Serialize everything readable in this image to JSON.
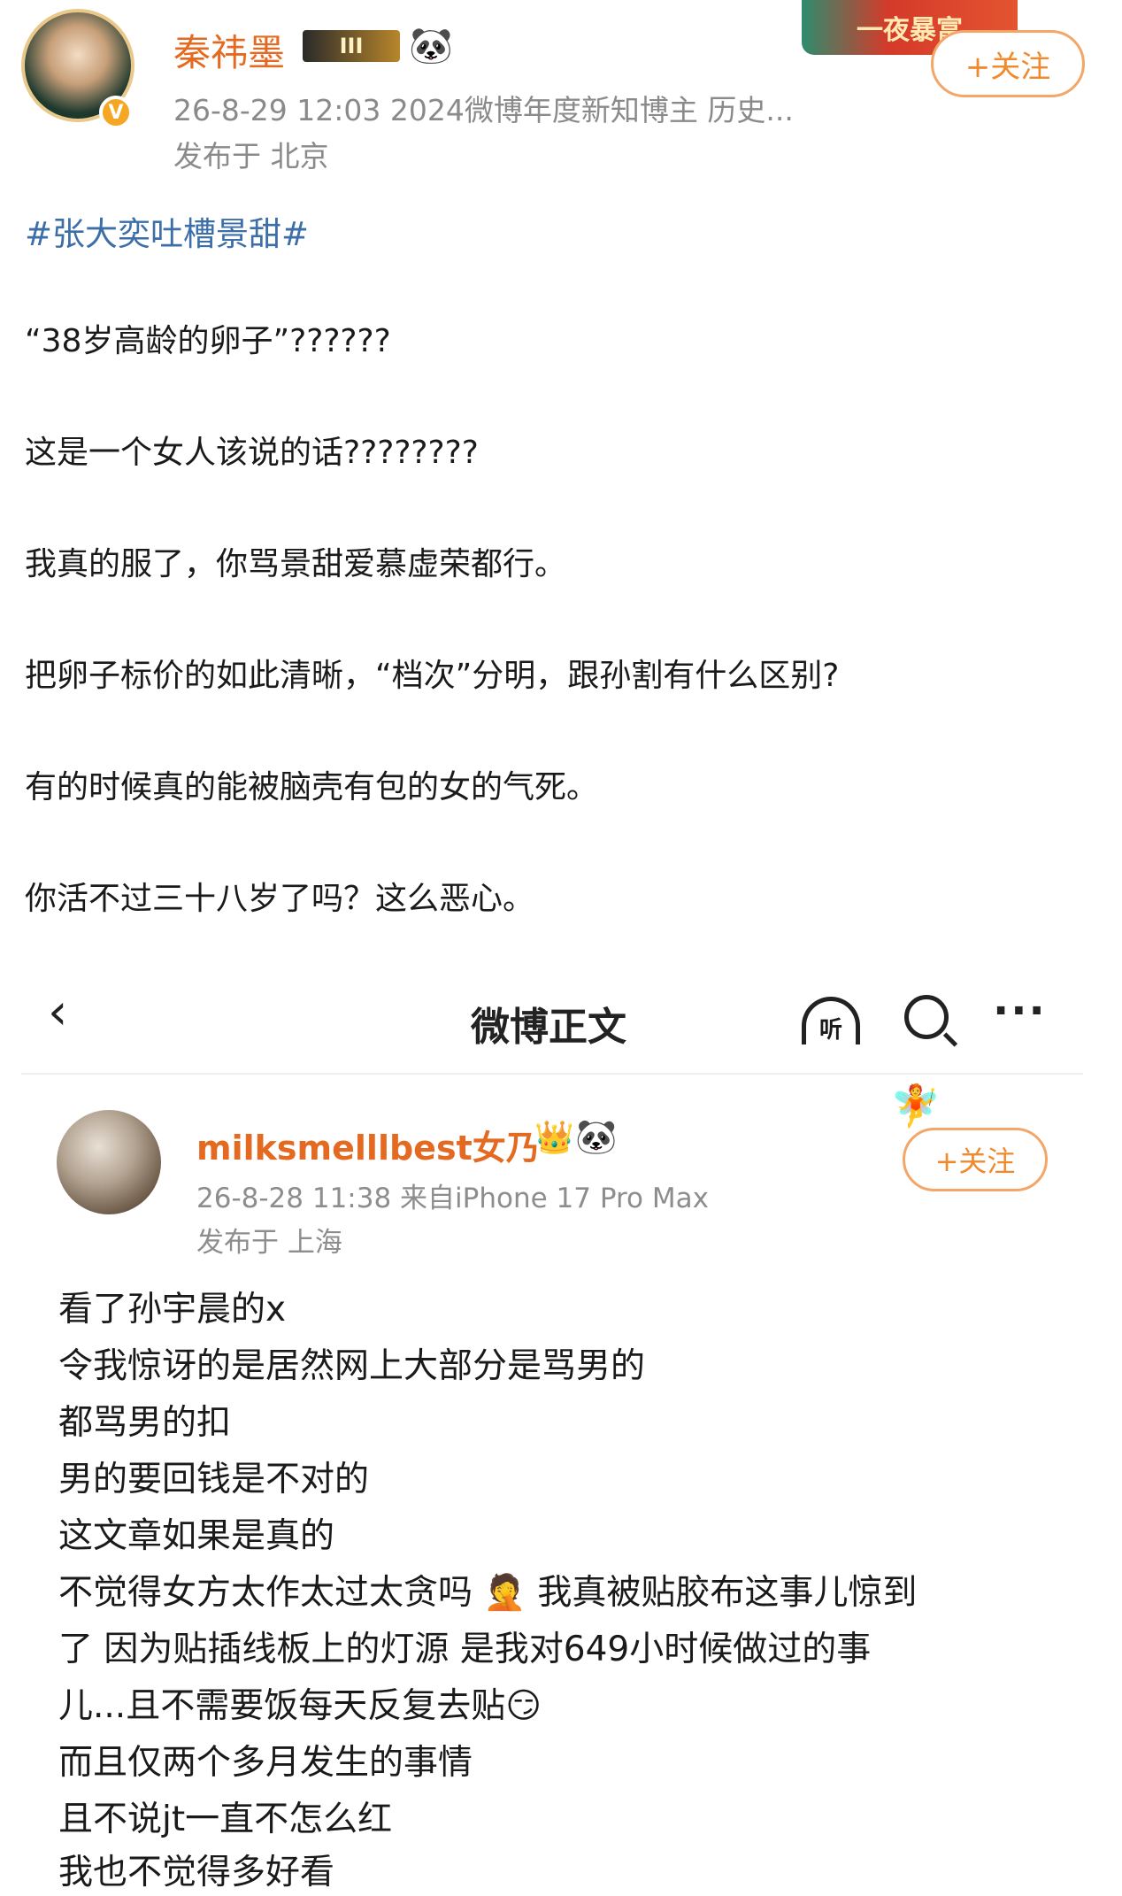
{
  "header": {
    "user_name": "秦祎墨",
    "level_badge": "III",
    "meta": "26-8-29 12:03  2024微博年度新知博主 历史...",
    "location": "发布于 北京",
    "follow_label": "+关注",
    "banner_text": "一夜暴富",
    "avatar_badge": "V"
  },
  "post": {
    "topic": "#张大奕吐槽景甜#",
    "lines": [
      "“38岁高龄的卵子”??????",
      "这是一个女人该说的话????????",
      "我真的服了，你骂景甜爱慕虚荣都行。",
      "把卵子标价的如此清晰，“档次”分明，跟孙割有什么区别?",
      "有的时候真的能被脑壳有包的女的气死。",
      "你活不过三十八岁了吗？这么恶心。"
    ]
  },
  "embed": {
    "back_icon": "‹",
    "title": "微博正文",
    "listen_label": "听",
    "more_icon": "···",
    "user_name": "milksmelllbest女乃",
    "meta": "26-8-28 11:38  来自iPhone 17 Pro Max",
    "location": "发布于 上海",
    "follow_label": "+关注",
    "lines": [
      "看了孙宇晨的x",
      "令我惊讶的是居然网上大部分是骂男的",
      "都骂男的扣",
      "男的要回钱是不对的",
      "这文章如果是真的",
      "不觉得女方太作太过太贪吗 🤦 我真被贴胶布这事儿惊到",
      "了 因为贴插线板上的灯源 是我对649小时候做过的事",
      "儿...且不需要饭每天反复去贴😏",
      "而且仅两个多月发生的事情",
      "且不说jt一直不怎么红",
      "我也不觉得多好看"
    ]
  },
  "icons": {
    "panda": "🐼",
    "crown": "👑",
    "decoration": "🧚"
  },
  "colors": {
    "username": "#e46a21",
    "topic_link": "#3c6ea8",
    "follow_border": "#f3a668",
    "meta_gray": "#8a8a8a"
  }
}
